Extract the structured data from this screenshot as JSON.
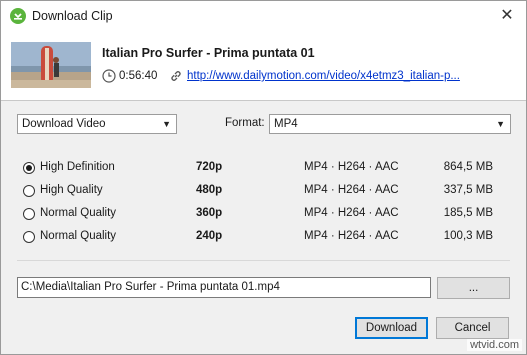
{
  "window": {
    "title": "Download Clip",
    "close_glyph": "✕",
    "accent_color": "#5ab43c"
  },
  "clip": {
    "title": "Italian Pro Surfer - Prima puntata 01",
    "duration": "0:56:40",
    "url": "http://www.dailymotion.com/video/x4etmz3_italian-p..."
  },
  "options": {
    "action_selected": "Download Video",
    "format_label": "Format:",
    "format_selected": "MP4"
  },
  "qualities": [
    {
      "label": "High Definition",
      "resolution": "720p",
      "codec": "MP4 · H264 · AAC",
      "size": "864,5 MB",
      "selected": true
    },
    {
      "label": "High Quality",
      "resolution": "480p",
      "codec": "MP4 · H264 · AAC",
      "size": "337,5 MB",
      "selected": false
    },
    {
      "label": "Normal Quality",
      "resolution": "360p",
      "codec": "MP4 · H264 · AAC",
      "size": "185,5 MB",
      "selected": false
    },
    {
      "label": "Normal Quality",
      "resolution": "240p",
      "codec": "MP4 · H264 · AAC",
      "size": "100,3 MB",
      "selected": false
    }
  ],
  "output": {
    "path": "C:\\Media\\Italian Pro Surfer - Prima puntata 01.mp4",
    "browse_label": "..."
  },
  "buttons": {
    "download_label": "Download",
    "cancel_label": "Cancel"
  },
  "watermark": "wtvid.com"
}
